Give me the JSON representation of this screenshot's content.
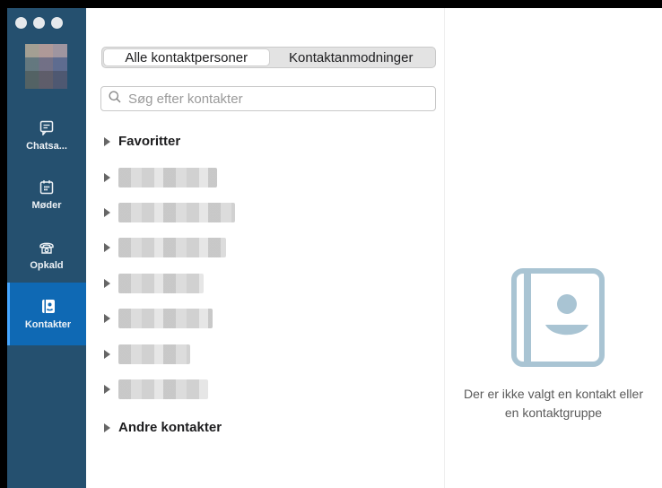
{
  "sidebar": {
    "items": [
      {
        "label": "Chatsa...",
        "icon": "chat-icon"
      },
      {
        "label": "Møder",
        "icon": "calendar-icon"
      },
      {
        "label": "Opkald",
        "icon": "phone-icon"
      },
      {
        "label": "Kontakter",
        "icon": "contacts-book-icon",
        "active": true
      }
    ]
  },
  "contacts": {
    "tabs": [
      "Alle kontaktpersoner",
      "Kontaktanmodninger"
    ],
    "search_placeholder": "Søg efter kontakter",
    "groups": {
      "favorites": "Favoritter",
      "other": "Andre kontakter"
    }
  },
  "detail": {
    "empty_text": "Der er ikke valgt en kontakt eller en kontaktgruppe"
  },
  "colors": {
    "sidebar_bg": "#25506f",
    "active_item_bg": "#0f69b4",
    "empty_icon": "#a9c4d3"
  }
}
